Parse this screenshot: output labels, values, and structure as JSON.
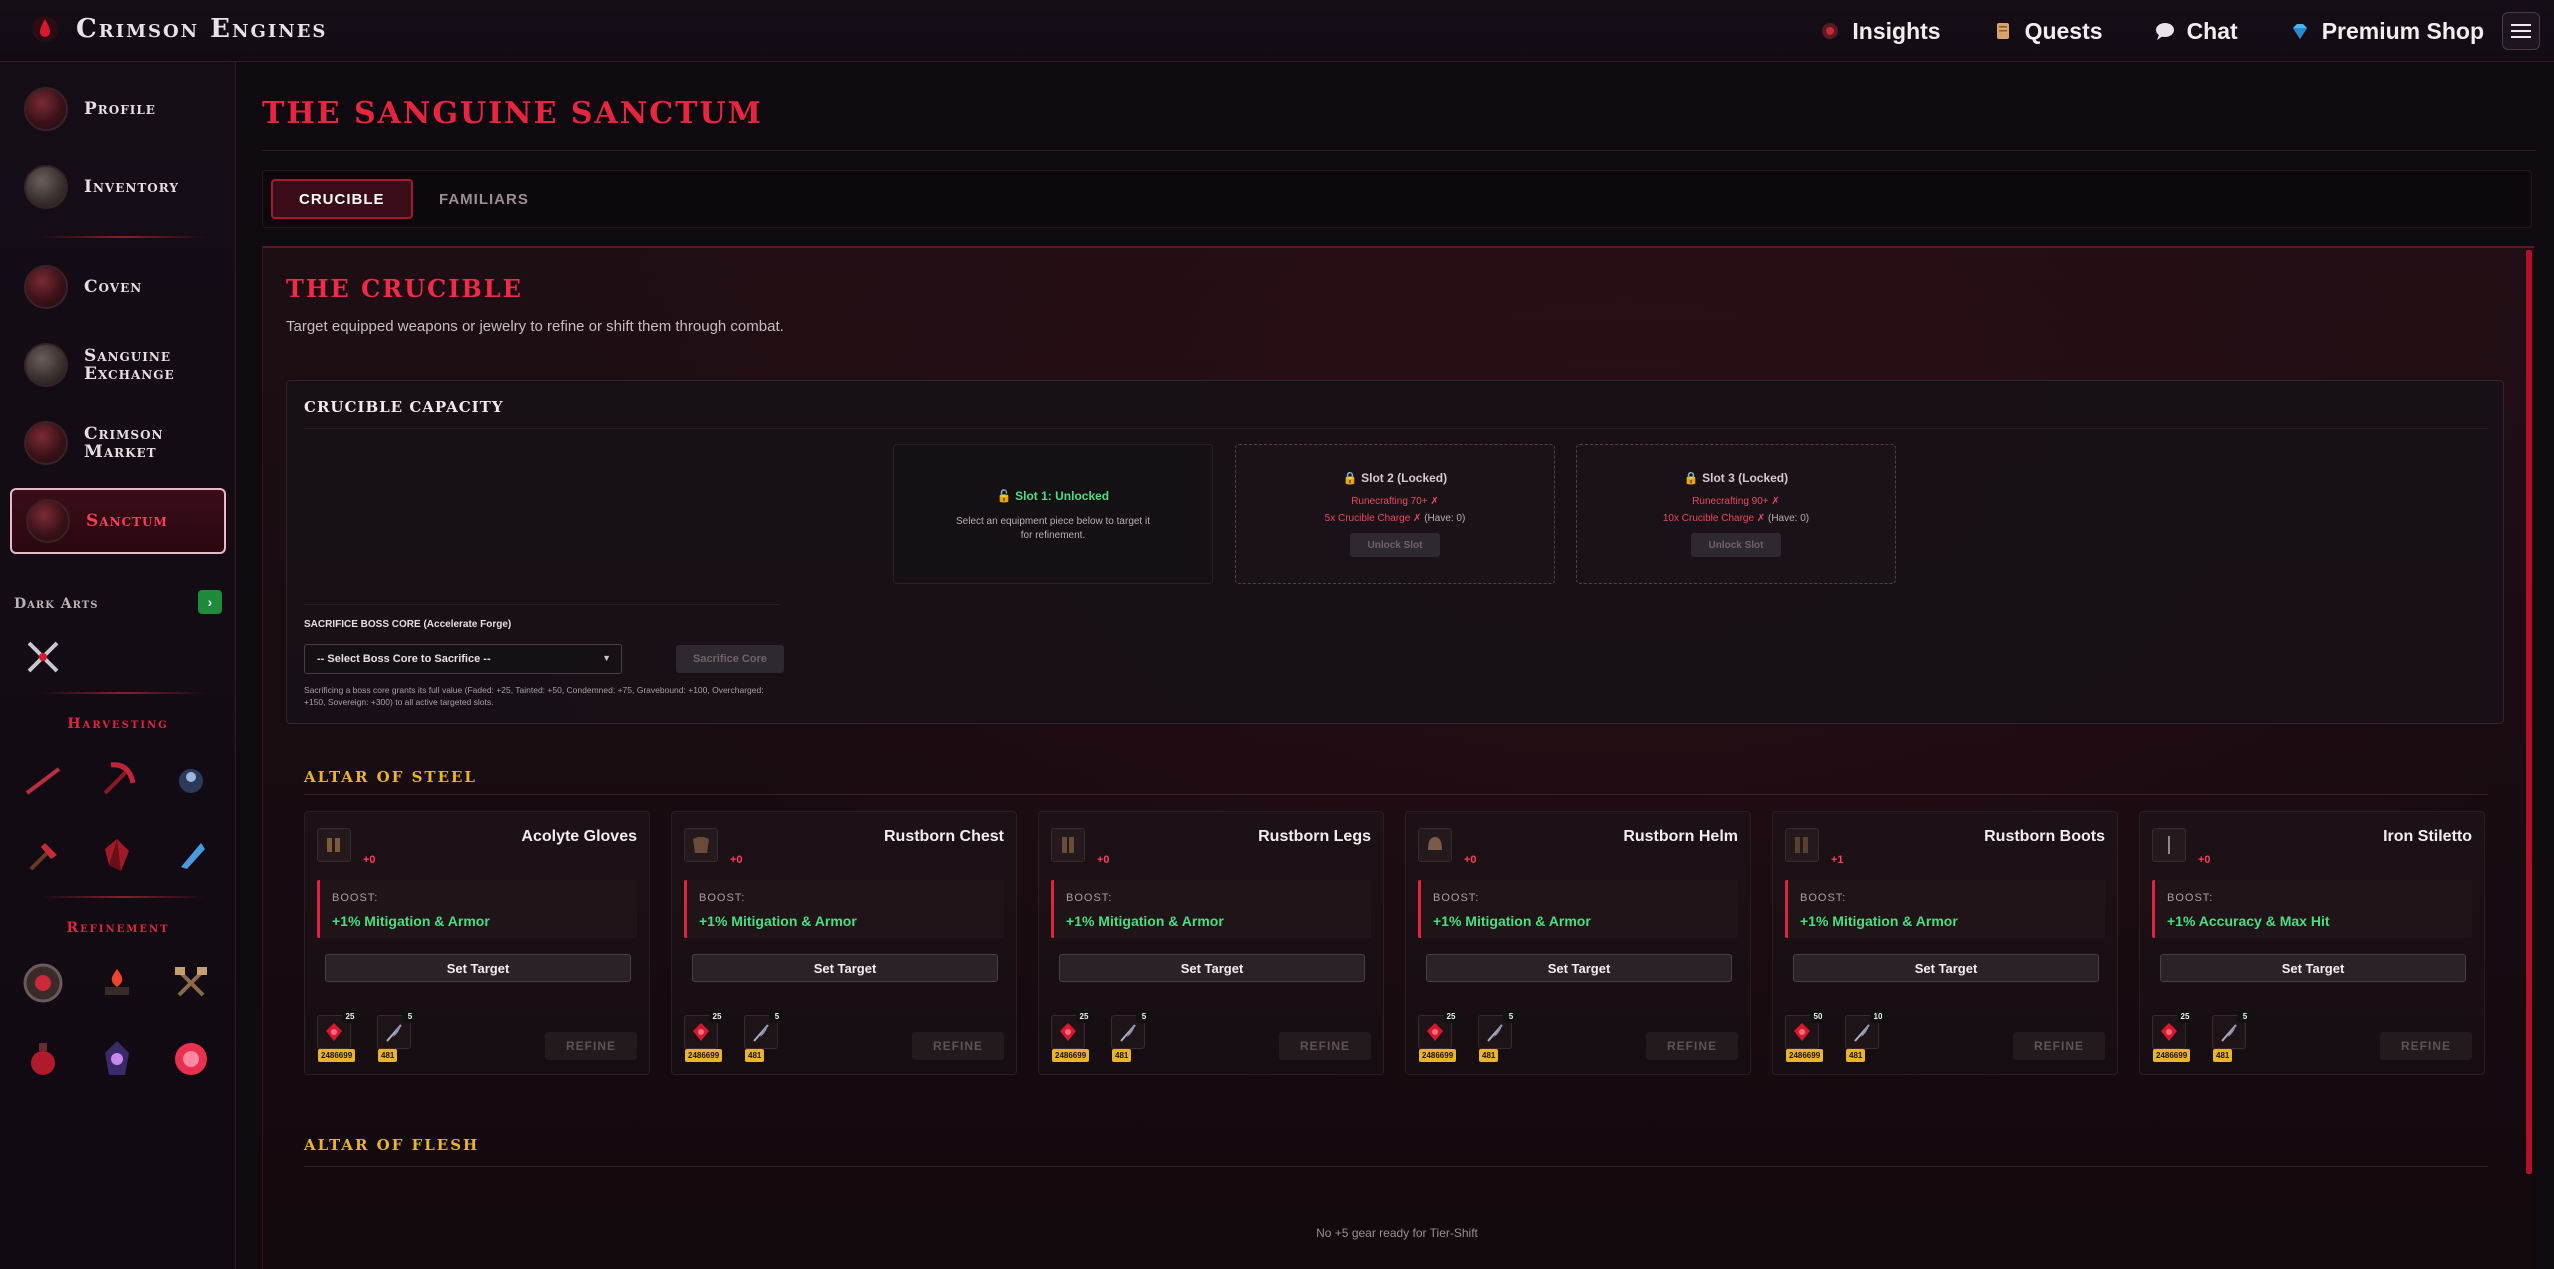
{
  "app": {
    "title": "Crimson Engines",
    "colors": {
      "accent": "#e8253f",
      "gold": "#e8b42a",
      "green": "#4ade80",
      "bg": "#0f0a10"
    }
  },
  "topnav": {
    "items": [
      {
        "label": "Insights",
        "icon": "insights-icon"
      },
      {
        "label": "Quests",
        "icon": "scroll-icon"
      },
      {
        "label": "Chat",
        "icon": "chat-bubble-icon"
      },
      {
        "label": "Premium Shop",
        "icon": "gem-icon"
      }
    ]
  },
  "sidebar": {
    "items": [
      {
        "label": "Profile"
      },
      {
        "label": "Inventory"
      },
      {
        "label": "Coven"
      },
      {
        "label": "Sanguine Exchange"
      },
      {
        "label": "Crimson Market"
      },
      {
        "label": "Sanctum",
        "active": true
      }
    ],
    "dark_arts_label": "Dark Arts",
    "dark_arts_toggle": "›",
    "harvesting_label": "Harvesting",
    "refinement_label": "Refinement"
  },
  "page": {
    "title": "The Sanguine Sanctum",
    "tabs": [
      {
        "label": "Crucible",
        "active": true
      },
      {
        "label": "Familiars",
        "active": false
      }
    ]
  },
  "crucible": {
    "title": "The Crucible",
    "subtitle": "Target equipped weapons or jewelry to refine or shift them through combat.",
    "capacity": {
      "title": "Crucible Capacity",
      "slots": [
        {
          "title": "🔓 Slot 1: Unlocked",
          "desc": "Select an equipment piece below to target it for refinement."
        },
        {
          "title": "🔒 Slot 2 (Locked)",
          "req1": "Runecrafting 70+ ✗",
          "req2": "5x Crucible Charge ✗",
          "have": "(Have: 0)",
          "button": "Unlock Slot"
        },
        {
          "title": "🔒 Slot 3 (Locked)",
          "req1": "Runecrafting 90+ ✗",
          "req2": "10x Crucible Charge ✗",
          "have": "(Have: 0)",
          "button": "Unlock Slot"
        }
      ]
    },
    "sacrifice": {
      "label": "SACRIFICE BOSS CORE (Accelerate Forge)",
      "select_value": "-- Select Boss Core to Sacrifice --",
      "button": "Sacrifice Core",
      "note": "Sacrificing a boss core grants its full value (Faded: +25, Tainted: +50, Condemned: +75, Gravebound: +100, Overcharged: +150, Sovereign: +300) to all active targeted slots."
    }
  },
  "altar_steel": {
    "title": "Altar of Steel",
    "boost_label": "BOOST:",
    "set_target_label": "Set Target",
    "refine_label": "REFINE",
    "cards": [
      {
        "name": "Acolyte Gloves",
        "level": "+0",
        "boost": "+1% Mitigation & Armor",
        "mat1_count": "25",
        "mat1_qty": "2486699",
        "mat2_count": "5",
        "mat2_qty": "481",
        "icon": "gloves-icon"
      },
      {
        "name": "Rustborn Chest",
        "level": "+0",
        "boost": "+1% Mitigation & Armor",
        "mat1_count": "25",
        "mat1_qty": "2486699",
        "mat2_count": "5",
        "mat2_qty": "481",
        "icon": "chest-armor-icon"
      },
      {
        "name": "Rustborn Legs",
        "level": "+0",
        "boost": "+1% Mitigation & Armor",
        "mat1_count": "25",
        "mat1_qty": "2486699",
        "mat2_count": "5",
        "mat2_qty": "481",
        "icon": "legs-armor-icon"
      },
      {
        "name": "Rustborn Helm",
        "level": "+0",
        "boost": "+1% Mitigation & Armor",
        "mat1_count": "25",
        "mat1_qty": "2486699",
        "mat2_count": "5",
        "mat2_qty": "481",
        "icon": "helm-icon"
      },
      {
        "name": "Rustborn Boots",
        "level": "+1",
        "boost": "+1% Mitigation & Armor",
        "mat1_count": "50",
        "mat1_qty": "2486699",
        "mat2_count": "10",
        "mat2_qty": "481",
        "icon": "boots-icon"
      },
      {
        "name": "Iron Stiletto",
        "level": "+0",
        "boost": "+1% Accuracy & Max Hit",
        "mat1_count": "25",
        "mat1_qty": "2486699",
        "mat2_count": "5",
        "mat2_qty": "481",
        "icon": "dagger-icon"
      }
    ]
  },
  "altar_flesh": {
    "title": "Altar of Flesh",
    "empty_message": "No +5 gear ready for Tier-Shift"
  }
}
